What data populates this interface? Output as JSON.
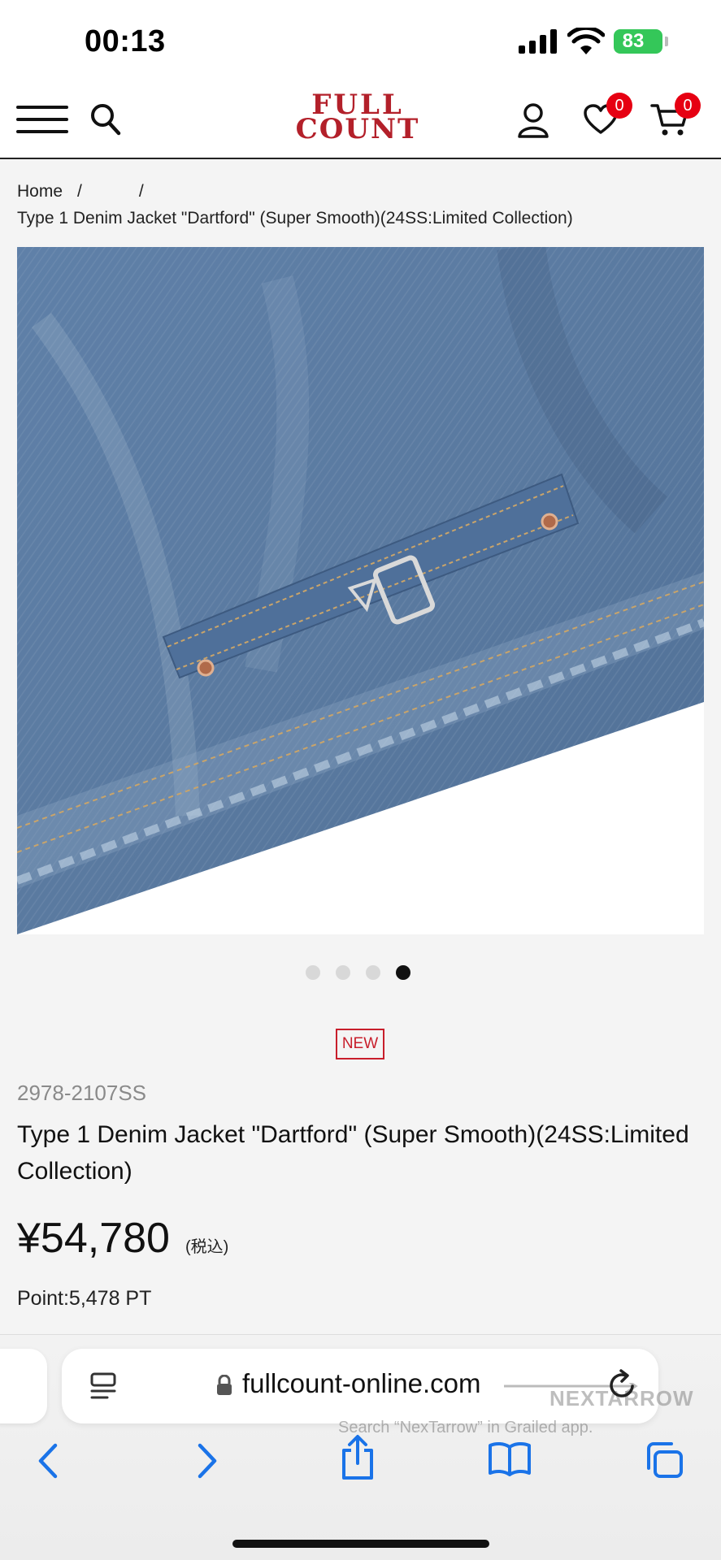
{
  "status_bar": {
    "time": "00:13",
    "battery": "83"
  },
  "header": {
    "logo_line1": "FULL",
    "logo_line2": "COUNT",
    "wishlist_count": "0",
    "cart_count": "0"
  },
  "breadcrumb": {
    "home": "Home",
    "separator": "/",
    "current": "Type 1 Denim Jacket \"Dartford\" (Super Smooth)(24SS:Limited Collection)"
  },
  "carousel": {
    "total": 4,
    "active_index": 3
  },
  "product": {
    "badge": "NEW",
    "sku": "2978-2107SS",
    "title": "Type 1 Denim Jacket \"Dartford\" (Super Smooth)(24SS:Limited Collection)",
    "price": "¥54,780",
    "tax_note": "(税込)",
    "points": "Point:5,478 PT"
  },
  "browser": {
    "url": "fullcount-online.com",
    "watermark_text": "Search “NexTarrow” in Grailed app.",
    "watermark_brand": "NEXTARROW"
  },
  "colors": {
    "brand_red": "#b3202a",
    "badge_red": "#e60012",
    "ios_blue": "#1a73e8",
    "battery_green": "#34c759"
  }
}
